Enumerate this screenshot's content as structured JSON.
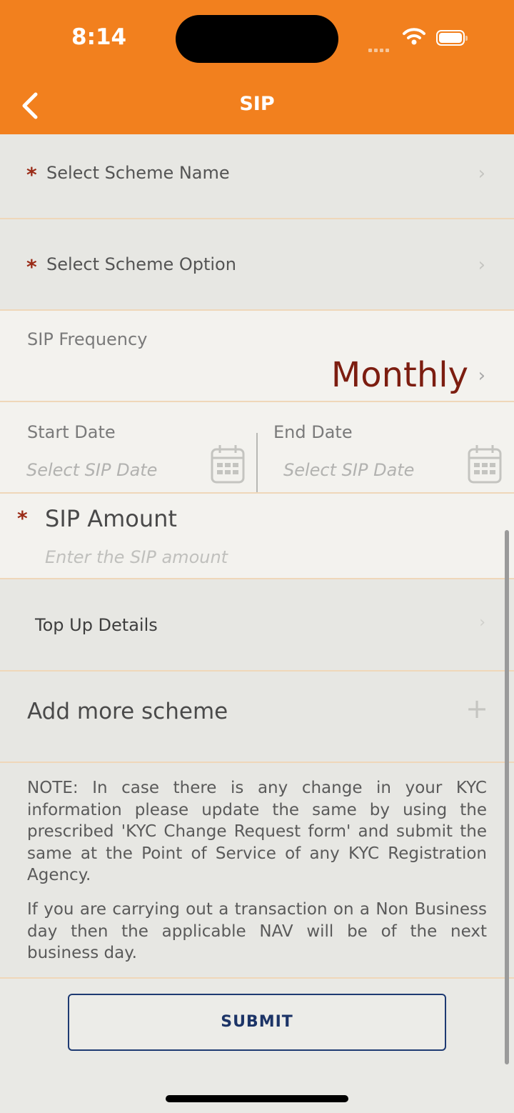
{
  "status_bar": {
    "time": "8:14"
  },
  "header": {
    "title": "SIP"
  },
  "form": {
    "scheme_name": {
      "required_mark": "*",
      "label": "Select Scheme Name"
    },
    "scheme_option": {
      "required_mark": "*",
      "label": "Select Scheme Option"
    },
    "sip_frequency": {
      "label": "SIP Frequency",
      "value": "Monthly"
    },
    "start_date": {
      "label": "Start Date",
      "placeholder": "Select SIP Date"
    },
    "end_date": {
      "label": "End Date",
      "placeholder": "Select SIP Date"
    },
    "sip_amount": {
      "required_mark": "*",
      "label": "SIP Amount",
      "placeholder": "Enter the SIP amount"
    },
    "top_up": {
      "label": "Top Up Details"
    },
    "add_scheme": {
      "label": "Add more scheme",
      "icon": "+"
    }
  },
  "notes": [
    "NOTE: In case there is any change in your KYC information please update the same by using the prescribed 'KYC Change Request form' and submit the same at the Point of Service of any KYC Registration Agency.",
    "If you are carrying out a transaction on a Non Business day then the applicable NAV will be of the next business day."
  ],
  "submit_label": "SUBMIT",
  "colors": {
    "header": "#f2801e",
    "accent": "#9a2b17",
    "button_border": "#1e3a72"
  }
}
